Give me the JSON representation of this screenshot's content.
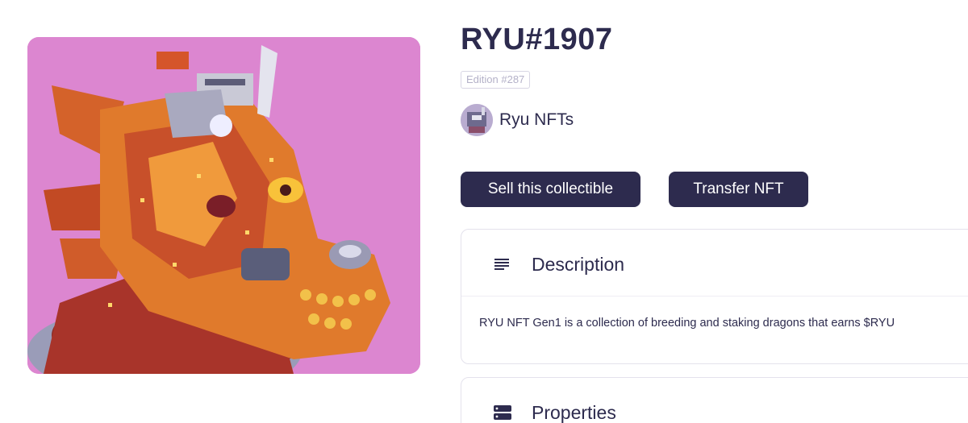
{
  "nft": {
    "title": "RYU#1907",
    "edition": "Edition #287",
    "image_icon": "pixel-dragon-artwork",
    "background_color": "#dc86d0"
  },
  "collection": {
    "name": "Ryu NFTs",
    "avatar_icon": "collection-avatar"
  },
  "actions": {
    "sell_label": "Sell this collectible",
    "transfer_label": "Transfer NFT"
  },
  "description": {
    "title": "Description",
    "icon": "lines-icon",
    "text": "RYU NFT Gen1 is a collection of breeding and staking dragons that earns $RYU"
  },
  "properties": {
    "title": "Properties",
    "icon": "server-icon"
  },
  "colors": {
    "primary": "#2d2b4e",
    "border": "#e4e2ec"
  }
}
